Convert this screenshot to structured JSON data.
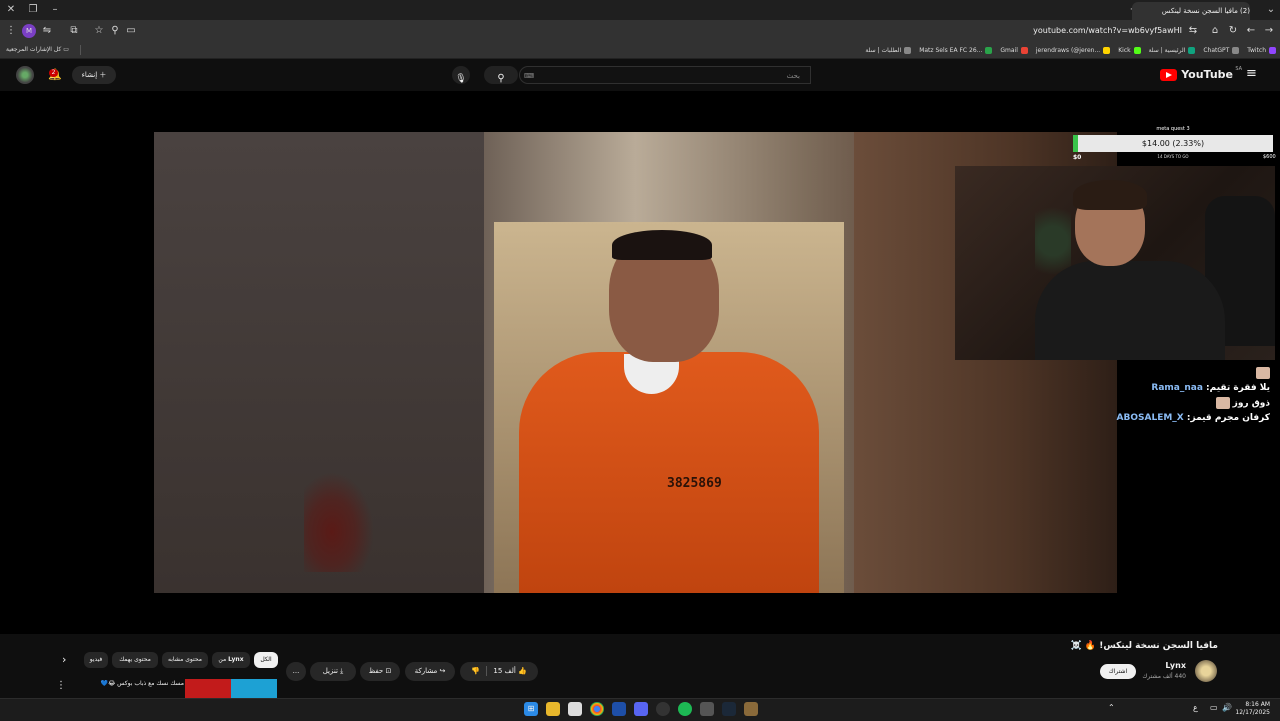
{
  "browser": {
    "active_tab_title": "(2) مافيا السجن نسخة لينكس",
    "url": "youtube.com/watch?v=wb6vyf5awHI",
    "bookmarks_all_label": "كل الإشارات المرجعية",
    "bookmarks": [
      {
        "label": "Twitch",
        "color": "#9146ff"
      },
      {
        "label": "ChatGPT",
        "color": "#888888"
      },
      {
        "label": "الرئيسية | سلة",
        "color": "#10a37f"
      },
      {
        "label": "Kick",
        "color": "#53fc18"
      },
      {
        "label": "jerendraws (@jeren...",
        "color": "#ffd400"
      },
      {
        "label": "Gmail",
        "color": "#ea4335"
      },
      {
        "label": "Matz Sels EA FC 26...",
        "color": "#2aa34a"
      },
      {
        "label": "الطلبات | سلة",
        "color": "#888888"
      }
    ]
  },
  "youtube": {
    "logo_text": "YouTube",
    "country_code": "SA",
    "search_placeholder": "بحث",
    "create_label": "إنشاء",
    "notification_count": "2"
  },
  "overlay": {
    "goal_title": "meta quest 3",
    "goal_amount": "$14.00 (2.33%)",
    "goal_progress_pct": 2.33,
    "goal_min": "$0",
    "goal_days": "14 DAYS TO GO",
    "goal_max": "$600",
    "jumpsuit_number": "3825869",
    "chat": [
      {
        "user": "Rama_naa",
        "message": "يلا فقرة تقيم"
      },
      {
        "user": "",
        "message": "ذوق روز"
      },
      {
        "user": "ABOSALEM_X",
        "message": "كرفان مجرم قيمز"
      }
    ]
  },
  "video": {
    "title": "مافيا السجن نسخة لينكس! 🔥 ☠️",
    "channel_name": "Lynx",
    "subscribers": "440 ألف مشترك",
    "subscribe_label": "اشتراك",
    "likes": "15 ألف",
    "share_label": "مشاركة",
    "save_label": "حفظ",
    "download_label": "تنزيل",
    "more_label": "..."
  },
  "chips": {
    "all": "الكل",
    "from": "من",
    "from_channel": "Lynx",
    "related": "محتوى مشابه",
    "for_you": "محتوى يهمك",
    "video": "فيديو"
  },
  "recommendation": {
    "title": "مسك نسك مع ذباب بوكس 😂💙"
  },
  "taskbar": {
    "time": "8:16 AM",
    "date": "12/17/2025",
    "lang": "ع"
  },
  "colors": {
    "youtube_red": "#ff0000",
    "goal_green": "#39c44a",
    "chat_user": "#8bbcf5"
  }
}
